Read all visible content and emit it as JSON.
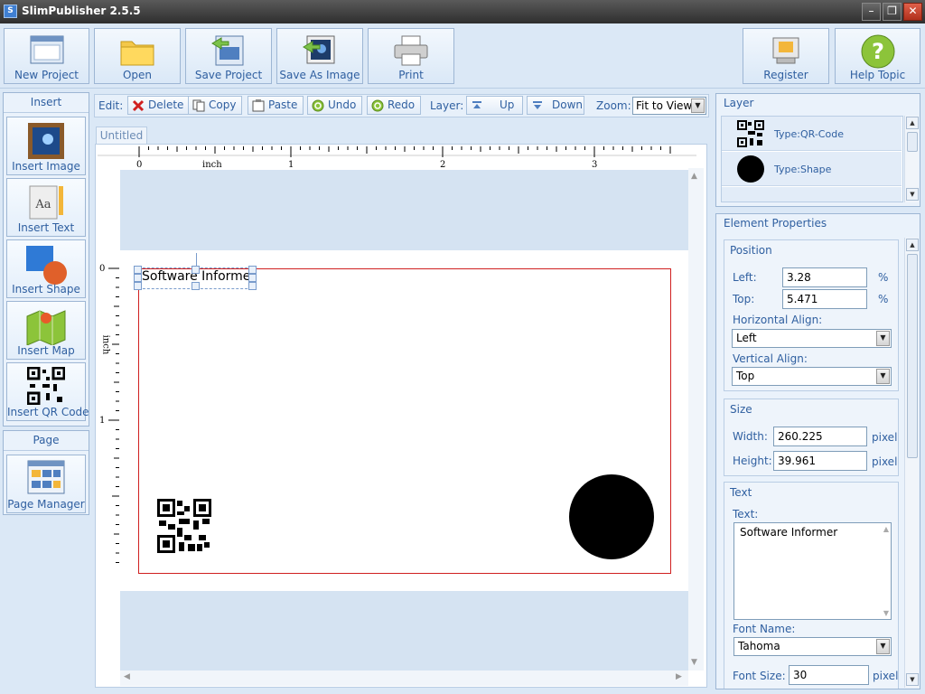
{
  "window": {
    "title": "SlimPublisher 2.5.5",
    "app_icon": "S"
  },
  "toolbar": {
    "new_project": "New Project",
    "open": "Open",
    "save_project": "Save Project",
    "save_as_image": "Save As Image",
    "print": "Print",
    "register": "Register",
    "help_topic": "Help Topic"
  },
  "insert_panel": {
    "header": "Insert",
    "insert_image": "Insert Image",
    "insert_text": "Insert Text",
    "insert_shape": "Insert Shape",
    "insert_map": "Insert Map",
    "insert_qr_code": "Insert QR Code"
  },
  "page_panel": {
    "header": "Page",
    "page_manager": "Page Manager"
  },
  "editbar": {
    "edit_label": "Edit:",
    "delete": "Delete",
    "copy": "Copy",
    "paste": "Paste",
    "undo": "Undo",
    "redo": "Redo",
    "layer_label": "Layer:",
    "up": "Up",
    "down": "Down",
    "zoom_label": "Zoom:",
    "zoom_value": "Fit to View"
  },
  "document": {
    "tab": "Untitled",
    "ruler_unit": "inch",
    "ruler_top_numbers": [
      "0",
      "1",
      "2",
      "3"
    ],
    "ruler_left_numbers": [
      "0",
      "1"
    ],
    "text_element": "Software Informer"
  },
  "layer_panel": {
    "header": "Layer",
    "items": [
      {
        "type": "Type:QR-Code",
        "icon": "qr-code-icon"
      },
      {
        "type": "Type:Shape",
        "icon": "circle-shape-icon"
      }
    ]
  },
  "properties": {
    "header": "Element Properties",
    "position": {
      "header": "Position",
      "left_label": "Left:",
      "left_value": "3.28",
      "left_unit": "%",
      "top_label": "Top:",
      "top_value": "5.471",
      "top_unit": "%",
      "halign_label": "Horizontal Align:",
      "halign_value": "Left",
      "valign_label": "Vertical Align:",
      "valign_value": "Top"
    },
    "size": {
      "header": "Size",
      "width_label": "Width:",
      "width_value": "260.225",
      "width_unit": "pixel",
      "height_label": "Height:",
      "height_value": "39.961",
      "height_unit": "pixel"
    },
    "text": {
      "header": "Text",
      "text_label": "Text:",
      "text_value": "Software Informer",
      "font_name_label": "Font Name:",
      "font_name_value": "Tahoma",
      "font_size_label": "Font Size:",
      "font_size_value": "30",
      "font_size_unit": "pixel"
    }
  },
  "colors": {
    "accent": "#2f5fa0",
    "page_border": "#d02020",
    "panel_bg": "#dbe8f6"
  }
}
